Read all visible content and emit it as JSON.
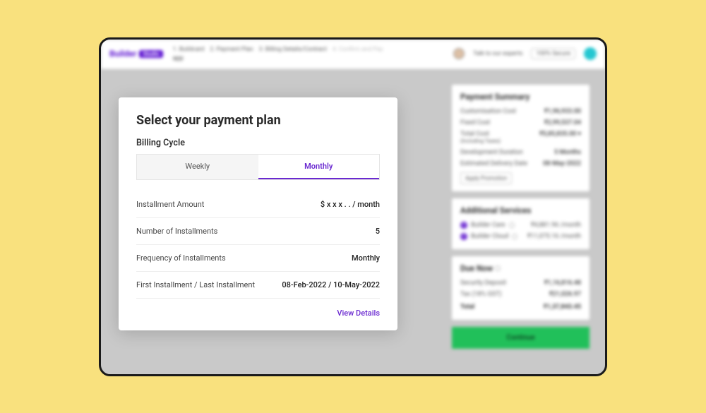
{
  "logo": {
    "text": "Builder",
    "badge": "Studio"
  },
  "breadcrumbs": {
    "step1": "1. Buildcard",
    "step2": "2. Payment Plan",
    "step3": "3. Billing Details/Contract",
    "step4": "4. Confirm and Pay",
    "project": "app"
  },
  "topRight": {
    "experts": "Talk to our experts",
    "secure": "100% Secure"
  },
  "modal": {
    "title": "Select your payment plan",
    "billingCycleLabel": "Billing Cycle",
    "tabs": {
      "weekly": "Weekly",
      "monthly": "Monthly"
    },
    "rows": [
      {
        "label": "Installment Amount",
        "value": "$ x x x . . / month"
      },
      {
        "label": "Number of Installments",
        "value": "5"
      },
      {
        "label": "Frequency of Installments",
        "value": "Monthly"
      },
      {
        "label": "First Installment / Last Installment",
        "value": "08-Feb-2022 / 10-May-2022"
      }
    ],
    "viewDetails": "View Details"
  },
  "summary": {
    "title": "Payment Summary",
    "rows": [
      {
        "label": "Customisation Cost",
        "value": "₹1,96,933.00"
      },
      {
        "label": "Fixed Cost",
        "value": "₹2,99,537.04"
      }
    ],
    "total": {
      "label": "Total Cost",
      "sub": "(Including Taxes)",
      "value": "₹5,85,835.00"
    },
    "dev": [
      {
        "label": "Development Duration",
        "value": "5 Months"
      },
      {
        "label": "Estimated Delivery Date",
        "value": "08-May-2022"
      }
    ],
    "promo": "Apply Promotion"
  },
  "services": {
    "title": "Additional Services",
    "items": [
      {
        "label": "Builder Care",
        "value": "₹4,881.96 /month"
      },
      {
        "label": "Builder Cloud",
        "value": "₹11,075.16 /month"
      }
    ]
  },
  "due": {
    "title": "Due Now",
    "rows": [
      {
        "label": "Security Deposit",
        "value": "₹1,16,816.48"
      },
      {
        "label": "Tax (18% GST)",
        "value": "₹21,026.97"
      }
    ],
    "total": {
      "label": "Total",
      "value": "₹1,37,843.45"
    }
  },
  "cta": "Continue"
}
